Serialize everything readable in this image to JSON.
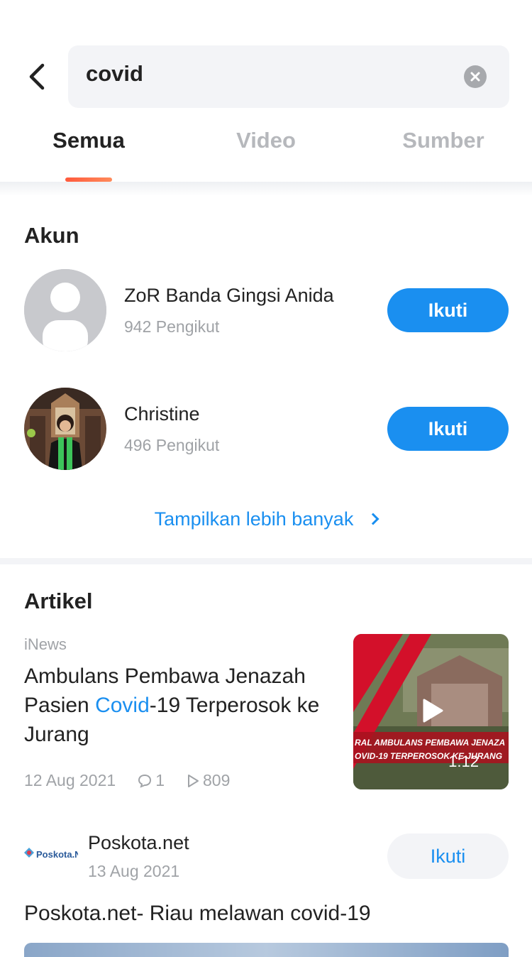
{
  "search": {
    "query": "covid"
  },
  "tabs": [
    {
      "label": "Semua",
      "active": true
    },
    {
      "label": "Video",
      "active": false
    },
    {
      "label": "Sumber",
      "active": false
    }
  ],
  "accounts_section": {
    "title": "Akun",
    "items": [
      {
        "name": "ZoR Banda Gingsi Anida",
        "followers": "942 Pengikut",
        "button": "Ikuti",
        "avatar": "default-user-icon"
      },
      {
        "name": "Christine",
        "followers": "496 Pengikut",
        "button": "Ikuti",
        "avatar": "profile-photo"
      }
    ],
    "show_more": "Tampilkan lebih banyak"
  },
  "articles_section": {
    "title": "Artikel",
    "article": {
      "source": "iNews",
      "title_before": "Ambulans Pembawa Jenazah Pasien ",
      "title_highlight": "Covid",
      "title_after": "-19 Terperosok ke Jurang",
      "date": "12 Aug 2021",
      "comments": "1",
      "views": "809",
      "duration": "1:12",
      "thumb_caption_line1": "RAL AMBULANS PEMBAWA JENAZA",
      "thumb_caption_line2": "OVID-19 TERPEROSOK KE JURANG"
    },
    "post": {
      "publisher": "Poskota.net",
      "date": "13 Aug 2021",
      "button": "Ikuti",
      "logo_text": "Poskota.Net",
      "text": "Poskota.net- Riau melawan covid-19"
    }
  },
  "colors": {
    "accent": "#1a8ff0",
    "tab_indicator": "#ff6a48",
    "muted": "#a0a3a7"
  }
}
